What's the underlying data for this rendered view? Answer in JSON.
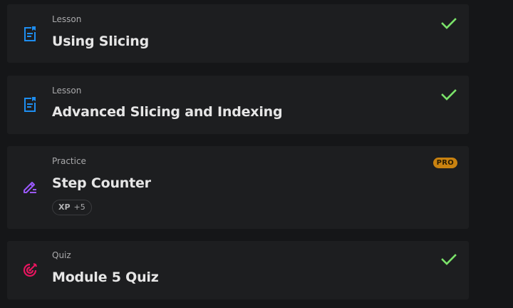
{
  "colors": {
    "background": "#151618",
    "card": "#1d1e20",
    "lesson_icon": "#1e8ef0",
    "practice_icon": "#9b59ff",
    "quiz_icon": "#e8155f",
    "check": "#7be36a",
    "pro_badge": "#c98210"
  },
  "items": [
    {
      "type": "Lesson",
      "title": "Using Slicing",
      "icon": "lesson-document-icon",
      "status": "completed"
    },
    {
      "type": "Lesson",
      "title": "Advanced Slicing and Indexing",
      "icon": "lesson-document-icon",
      "status": "completed"
    },
    {
      "type": "Practice",
      "title": "Step Counter",
      "icon": "pencil-edit-icon",
      "badge": "PRO",
      "xp_label": "XP",
      "xp_value": "+5"
    },
    {
      "type": "Quiz",
      "title": "Module 5 Quiz",
      "icon": "target-icon",
      "status": "completed"
    }
  ]
}
